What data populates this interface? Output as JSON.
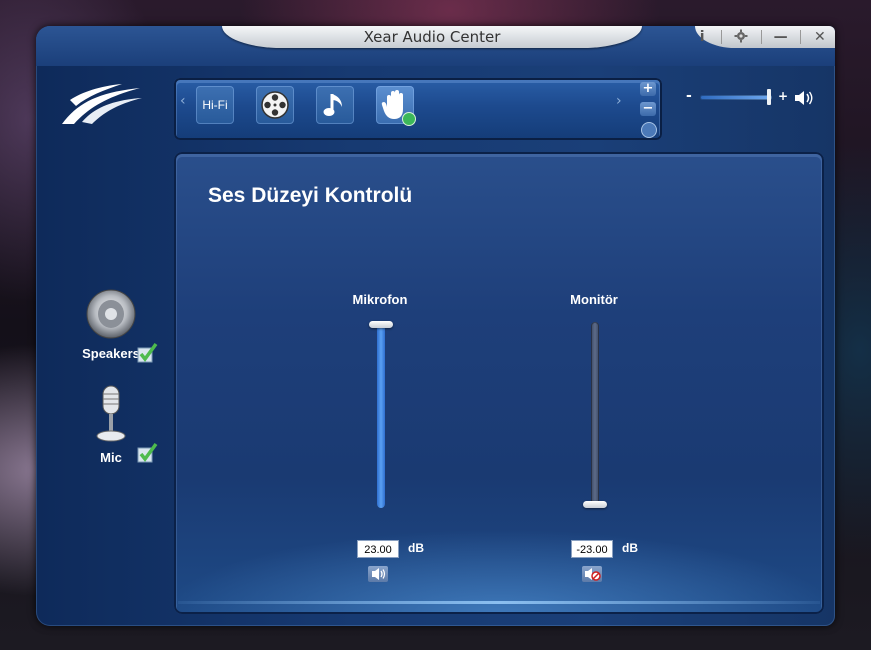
{
  "window": {
    "title": "Xear Audio Center",
    "controls": {
      "info": "i",
      "minimize": "—",
      "close": "✕"
    }
  },
  "toolbar": {
    "presets": [
      {
        "label": "Hi-Fi",
        "icon": "hifi-label",
        "active": false
      },
      {
        "label": "",
        "icon": "film-reel-icon",
        "active": false
      },
      {
        "label": "",
        "icon": "music-note-icon",
        "active": false
      },
      {
        "label": "",
        "icon": "hand-icon",
        "active": true
      }
    ],
    "add_label": "+",
    "remove_label": "−"
  },
  "master_volume": {
    "minus_label": "-",
    "plus_label": "+",
    "level": 0.96
  },
  "devices": [
    {
      "label": "Speakers",
      "icon": "speaker-icon",
      "enabled": true
    },
    {
      "label": "Mic",
      "icon": "microphone-icon",
      "enabled": true
    }
  ],
  "panel": {
    "title": "Ses Düzeyi Kontrolü",
    "channels": [
      {
        "label": "Mikrofon",
        "value": "23.00",
        "unit": "dB",
        "level": 1.0,
        "muted": false
      },
      {
        "label": "Monitör",
        "value": "-23.00",
        "unit": "dB",
        "level": 0.0,
        "muted": true
      }
    ]
  },
  "colors": {
    "accent": "#3d7fd8",
    "check": "#3cb85a",
    "panel_bg": "#1e3f7a"
  }
}
